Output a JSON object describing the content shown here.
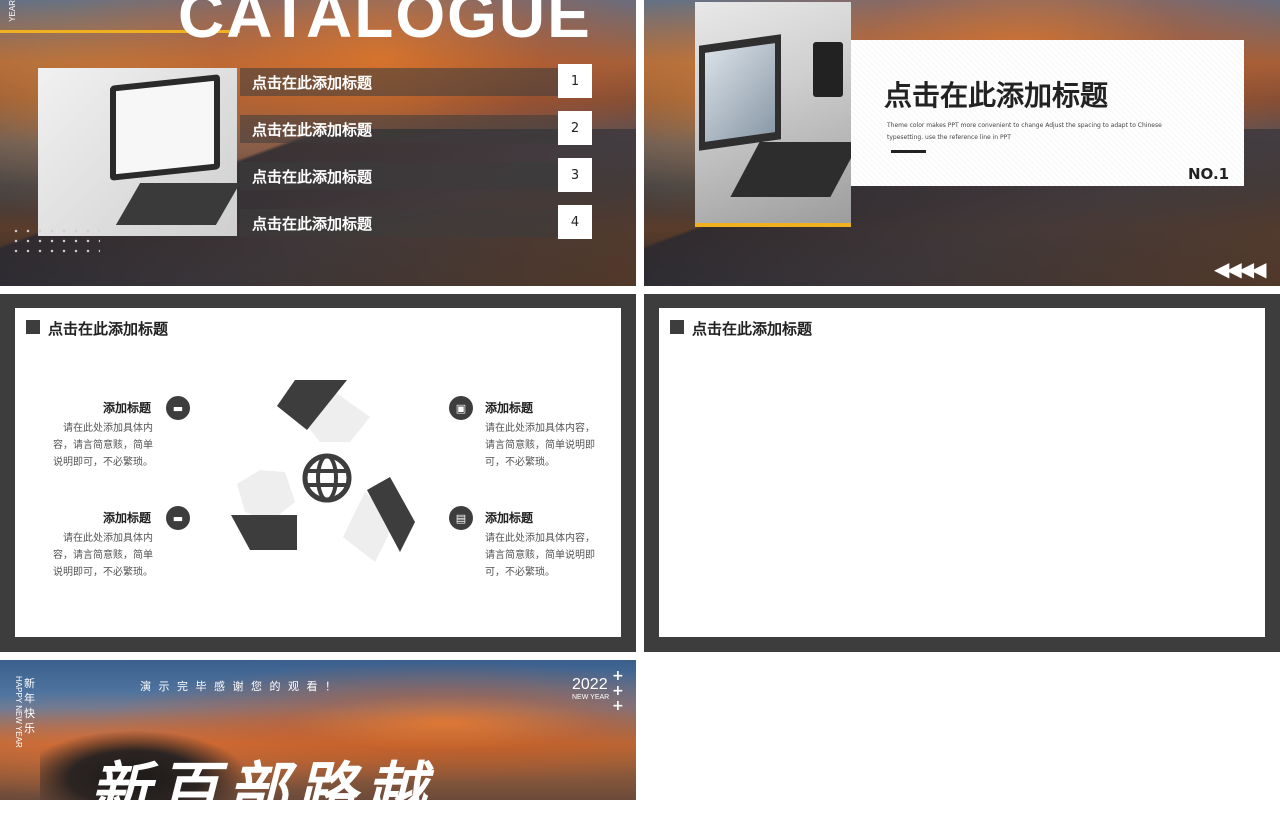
{
  "slide1": {
    "title": "CATALOGUE",
    "year_side": "YEAR",
    "items": [
      {
        "label": "点击在此添加标题",
        "num": "1"
      },
      {
        "label": "点击在此添加标题",
        "num": "2"
      },
      {
        "label": "点击在此添加标题",
        "num": "3"
      },
      {
        "label": "点击在此添加标题",
        "num": "4"
      }
    ]
  },
  "slide2": {
    "title": "点击在此添加标题",
    "desc": "Theme color makes PPT more convenient to change Adjust the spacing to adapt to Chinese typesetting. use the reference line in PPT",
    "no": "NO.1",
    "arrows": "◀◀◀◀"
  },
  "slide3": {
    "header": "点击在此添加标题",
    "items": [
      {
        "title": "添加标题",
        "text": "请在此处添加具体内容，请言简意赅，简单说明即可，不必繁琐。",
        "icon": "chat-icon"
      },
      {
        "title": "添加标题",
        "text": "请在此处添加具体内容，请言简意赅，简单说明即可，不必繁琐。",
        "icon": "chat-icon"
      },
      {
        "title": "添加标题",
        "text": "请在此处添加具体内容，请言简意赅，简单说明即可，不必繁琐。",
        "icon": "printer-icon"
      },
      {
        "title": "添加标题",
        "text": "请在此处添加具体内容，请言简意赅，简单说明即可，不必繁琐。",
        "icon": "briefcase-icon"
      }
    ],
    "center_icon": "globe-icon"
  },
  "slide4": {
    "header": "点击在此添加标题"
  },
  "slide5": {
    "tagline": "演 示 完 毕     感 谢 您 的 观 看 ！",
    "year": "2022",
    "new_year": "NEW YEAR",
    "side_cn": "新年快乐",
    "side_en": "HAPPY NEW YEAR",
    "brush_text": "新 百 部 路 越"
  }
}
